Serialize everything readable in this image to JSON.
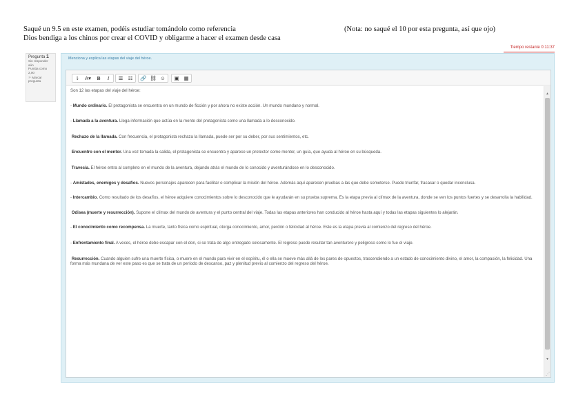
{
  "caption": {
    "line1": "Saqué un 9.5 en este examen, podéis estudiar tomándolo como referencia",
    "line2": "Dios bendiga a los chinos por crear el COVID y obligarme a hacer el examen desde casa",
    "note": "(Nota: no saqué el 10 por esta pregunta, así que ojo)"
  },
  "timer": "Tiempo restante 0:11:37",
  "question_info": {
    "label": "Pregunta",
    "number": "1",
    "status": "Sin responder aún",
    "marks": "Puntúa como 2,00",
    "flag": "Marcar pregunta"
  },
  "question_text": "Menciona y explica las etapas del viaje del héroe.",
  "toolbar": {
    "buttons": [
      {
        "name": "collapse-toolbar-button",
        "glyph": "⇂"
      },
      {
        "name": "font-style-button",
        "glyph": "A▾"
      },
      {
        "name": "bold-button",
        "glyph": "B"
      },
      {
        "name": "italic-button",
        "glyph": "I"
      },
      {
        "name": "bullet-list-button",
        "glyph": "☰"
      },
      {
        "name": "numbered-list-button",
        "glyph": "☷"
      },
      {
        "name": "link-button",
        "glyph": "🔗"
      },
      {
        "name": "unlink-button",
        "glyph": "⛓"
      },
      {
        "name": "emoji-button",
        "glyph": "☺"
      },
      {
        "name": "image-button",
        "glyph": "▣"
      },
      {
        "name": "media-button",
        "glyph": "▦"
      }
    ]
  },
  "answer": {
    "intro": "Son 12 las etapas del viaje del héroe:",
    "stages": [
      {
        "dash": true,
        "title": "Mundo ordinario",
        "text": "El protagonista se encuentra en un mundo de ficción y por ahora no existe acción. Un mundo mundano y normal."
      },
      {
        "dash": true,
        "title": "Llamada a la aventura",
        "text": "Llega información que actúa en la mente del protagonista como una llamada a lo desconocido."
      },
      {
        "dash": false,
        "title": "Rechazo de la llamada",
        "text": "Con frecuencia, el protagonista rechaza la llamada, puede ser por su deber, por sus sentimientos, etc."
      },
      {
        "dash": false,
        "title": "Encuentro con el mentor",
        "text": "Una vez tomada la salida, el protagonista se encuentra y aparece un protector como mentor, un guía, que ayuda al héroe en su búsqueda."
      },
      {
        "dash": false,
        "title": "Travesía",
        "text": "El héroe entra al completo en el mundo de la aventura, dejando atrás el mundo de lo conocido y aventurándose en lo desconocido."
      },
      {
        "dash": true,
        "title": "Amistades, enemigos y desafíos",
        "text": "Nuevos personajes aparecen para facilitar o complicar la misión del héroe. Además aquí aparecen pruebas a las que debe someterse. Puede triunfar, fracasar o quedar inconclusa."
      },
      {
        "dash": true,
        "title": "Intercambio",
        "text": "Como resultado de los desafíos, el héroe adquiere conocimientos sobre lo desconocido que le ayudarán en su prueba suprema. Es la etapa previa al clímax de la aventura, donde se ven los puntos fuertes y se desarrolla la habilidad."
      },
      {
        "dash": false,
        "title": "Odisea (muerte y resurrección)",
        "text": "Supone el clímax del mundo de aventura y el punto central del viaje. Todas las etapas anteriores han conducido al héroe hasta aquí y todas las etapas siguientes lo alejarán."
      },
      {
        "dash": true,
        "title": "El conocimiento como recompensa",
        "text": "La muerte, tanto física como espiritual, otorga conocimiento, amor, perdón o felicidad al héroe. Este es la etapa previa al comienzo del regreso del héroe."
      },
      {
        "dash": true,
        "title": "Enfrentamiento final",
        "text": "A veces, el héroe debe escapar con el don, si se trata de algo entregado celosamente. El regreso puede resultar tan aventurero y peligroso como lo fue el viaje."
      },
      {
        "dash": false,
        "title": "Resurrección",
        "text": "Cuando alguien sufre una muerte física, o muere en el mundo para vivir en el espíritu, él o ella se mueve más allá de los pares de opuestos, trascendiendo a un estado de conocimiento divino, el amor, la compasión, la felicidad. Una forma más mundana de ver este paso es que se trata de un período de descanso, paz y plenitud previo al comienzo del regreso del héroe."
      }
    ]
  }
}
